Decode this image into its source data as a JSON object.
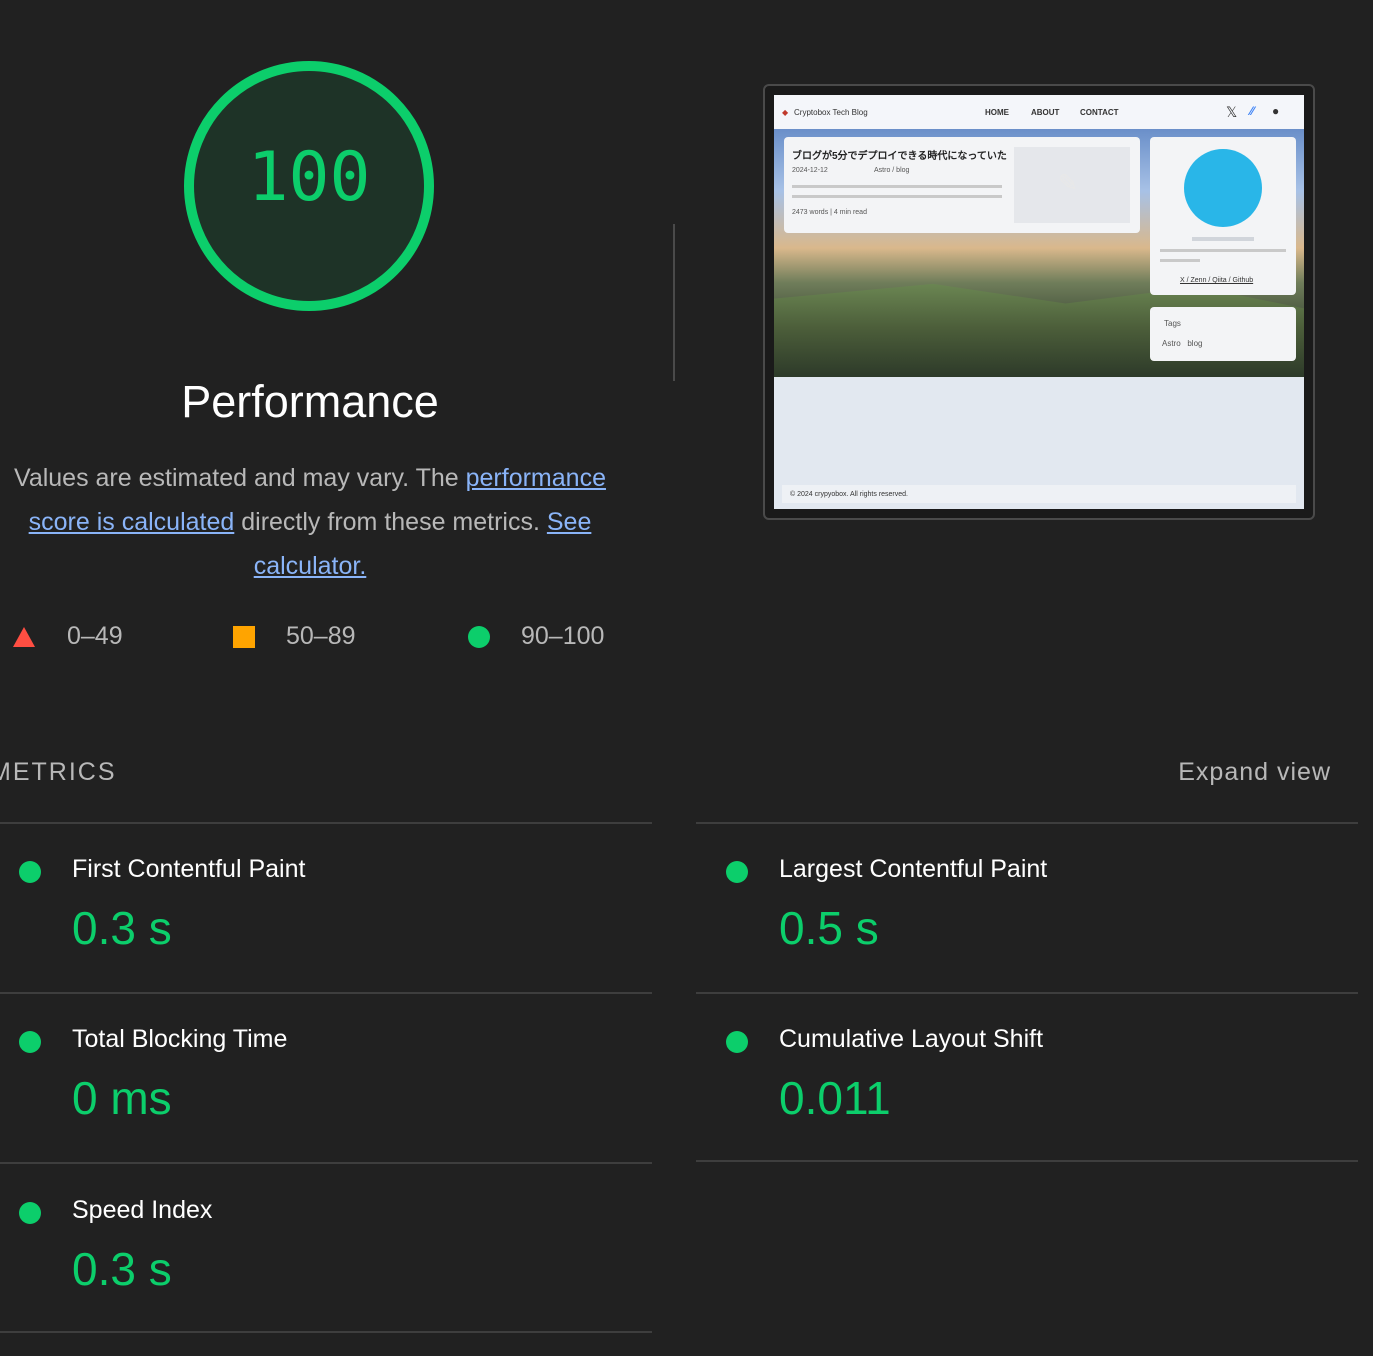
{
  "gauge": {
    "score": "100",
    "score_fraction": 1.0,
    "title": "Performance",
    "color": "#0cce6b"
  },
  "description": {
    "text_before": "Values are estimated and may vary. The ",
    "link1": "performance score is calculated",
    "text_middle": " directly from these metrics. ",
    "link2": "See calculator."
  },
  "legend": [
    {
      "shape": "triangle-icon",
      "range": "0–49",
      "color": "#ff4e42"
    },
    {
      "shape": "square-icon",
      "range": "50–89",
      "color": "#ffa400"
    },
    {
      "shape": "circle-icon",
      "range": "90–100",
      "color": "#0cce6b"
    }
  ],
  "screenshot": {
    "site_name": "Cryptobox Tech Blog",
    "nav": [
      "HOME",
      "ABOUT",
      "CONTACT"
    ],
    "post_title": "ブログが5分でデプロイできる時代になっていた",
    "post_date": "2024-12-12",
    "post_tags": "Astro / blog",
    "post_meta": "2473 words | 4 min read",
    "profile_links": "X / Zenn / Qiita / Github",
    "tags_label": "Tags",
    "tags": "Astro   blog",
    "footer": "© 2024 crypyobox. All rights reserved."
  },
  "metrics": {
    "title": "METRICS",
    "expand_label": "Expand view",
    "items": [
      {
        "label": "First Contentful Paint",
        "value": "0.3 s"
      },
      {
        "label": "Largest Contentful Paint",
        "value": "0.5 s"
      },
      {
        "label": "Total Blocking Time",
        "value": "0 ms"
      },
      {
        "label": "Cumulative Layout Shift",
        "value": "0.011"
      },
      {
        "label": "Speed Index",
        "value": "0.3 s"
      }
    ]
  }
}
